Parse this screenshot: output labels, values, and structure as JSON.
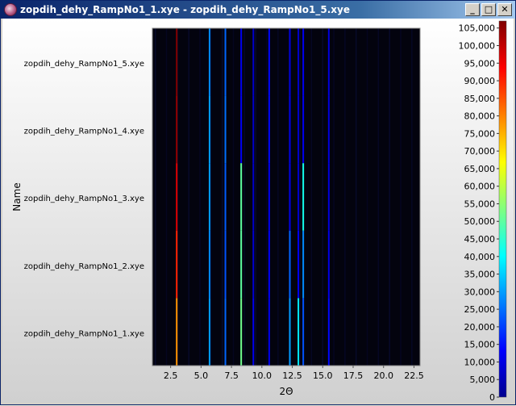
{
  "window": {
    "title": "zopdih_dehy_RampNo1_1.xye - zopdih_dehy_RampNo1_5.xye",
    "min_label": "_",
    "max_label": "□",
    "close_label": "✕"
  },
  "chart_data": {
    "type": "heatmap",
    "xlabel": "2Θ",
    "ylabel": "Name",
    "xlim": [
      1.0,
      23.0
    ],
    "xticks": [
      2.5,
      5.0,
      7.5,
      10.0,
      12.5,
      15.0,
      17.5,
      20.0,
      22.5
    ],
    "xtick_labels": [
      "2.5",
      "5.0",
      "7.5",
      "10.0",
      "12.5",
      "15.0",
      "17.5",
      "20.0",
      "22.5"
    ],
    "rows": [
      "zopdih_dehy_RampNo1_5.xye",
      "zopdih_dehy_RampNo1_4.xye",
      "zopdih_dehy_RampNo1_3.xye",
      "zopdih_dehy_RampNo1_2.xye",
      "zopdih_dehy_RampNo1_1.xye"
    ],
    "colorbar": {
      "min": 0,
      "max": 107000,
      "ticks": [
        0,
        5000,
        10000,
        15000,
        20000,
        25000,
        30000,
        35000,
        40000,
        45000,
        50000,
        55000,
        60000,
        65000,
        70000,
        75000,
        80000,
        85000,
        90000,
        95000,
        100000,
        105000
      ],
      "tick_labels": [
        "0",
        "5,000",
        "10,000",
        "15,000",
        "20,000",
        "25,000",
        "30,000",
        "35,000",
        "40,000",
        "45,000",
        "50,000",
        "55,000",
        "60,000",
        "65,000",
        "70,000",
        "75,000",
        "80,000",
        "85,000",
        "90,000",
        "95,000",
        "100,000",
        "105,000"
      ]
    },
    "peaks_2theta": [
      3.0,
      5.7,
      7.0,
      8.3,
      9.3,
      10.6,
      12.3,
      13.0,
      13.4,
      15.5
    ],
    "intensity": [
      [
        107000,
        28000,
        24000,
        12000,
        8000,
        14000,
        10000,
        8000,
        12000,
        10000
      ],
      [
        105000,
        30000,
        25000,
        13000,
        8000,
        14000,
        11000,
        8000,
        12000,
        10000
      ],
      [
        97000,
        30000,
        23000,
        50000,
        8000,
        12000,
        11000,
        8000,
        42000,
        10000
      ],
      [
        90000,
        28000,
        22000,
        50000,
        9000,
        13000,
        24000,
        12000,
        28000,
        11000
      ],
      [
        78000,
        30000,
        24000,
        52000,
        12000,
        12000,
        30000,
        38000,
        22000,
        14000
      ]
    ]
  }
}
